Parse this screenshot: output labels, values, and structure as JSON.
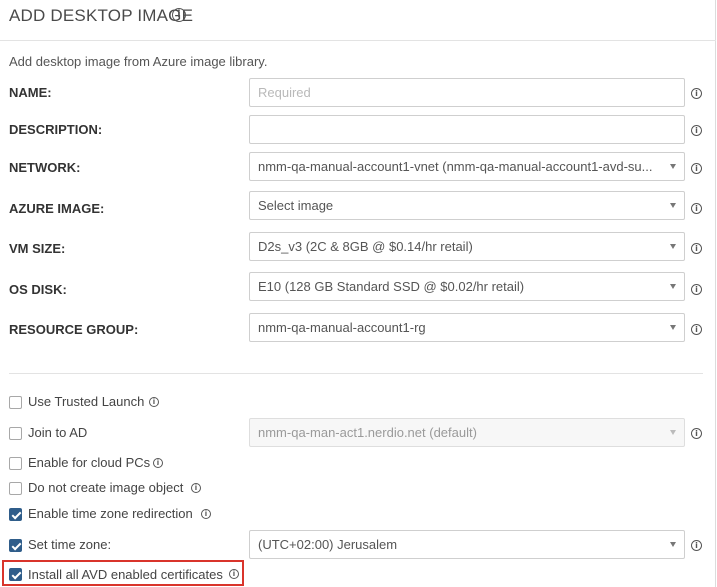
{
  "header": {
    "title": "ADD DESKTOP IMAGE"
  },
  "subtitle": "Add desktop image from Azure image library.",
  "fields": {
    "name": {
      "label": "NAME:",
      "placeholder": "Required",
      "value": ""
    },
    "description": {
      "label": "DESCRIPTION:",
      "value": ""
    },
    "network": {
      "label": "NETWORK:",
      "value": "nmm-qa-manual-account1-vnet (nmm-qa-manual-account1-avd-su..."
    },
    "azure_image": {
      "label": "AZURE IMAGE:",
      "value": "Select image"
    },
    "vm_size": {
      "label": "VM SIZE:",
      "value": "D2s_v3 (2C & 8GB @ $0.14/hr retail)"
    },
    "os_disk": {
      "label": "OS DISK:",
      "value": "E10 (128 GB Standard SSD @ $0.02/hr retail)"
    },
    "resource_group": {
      "label": "RESOURCE GROUP:",
      "value": "nmm-qa-manual-account1-rg"
    }
  },
  "options": {
    "trusted_launch": {
      "label": "Use Trusted Launch",
      "checked": false
    },
    "join_ad": {
      "label": "Join to AD",
      "checked": false,
      "select_value": "nmm-qa-man-act1.nerdio.net (default)"
    },
    "cloud_pcs": {
      "label": "Enable for cloud PCs",
      "checked": false
    },
    "no_image_object": {
      "label": "Do not create image object",
      "checked": false
    },
    "tz_redirection": {
      "label": "Enable time zone redirection",
      "checked": true
    },
    "set_time_zone": {
      "label": "Set time zone:",
      "checked": true,
      "select_value": "(UTC+02:00) Jerusalem"
    },
    "avd_certificates": {
      "label": "Install all AVD enabled certificates",
      "checked": true
    }
  },
  "colors": {
    "accent": "#2f5d8a",
    "highlight": "#d9342b"
  }
}
